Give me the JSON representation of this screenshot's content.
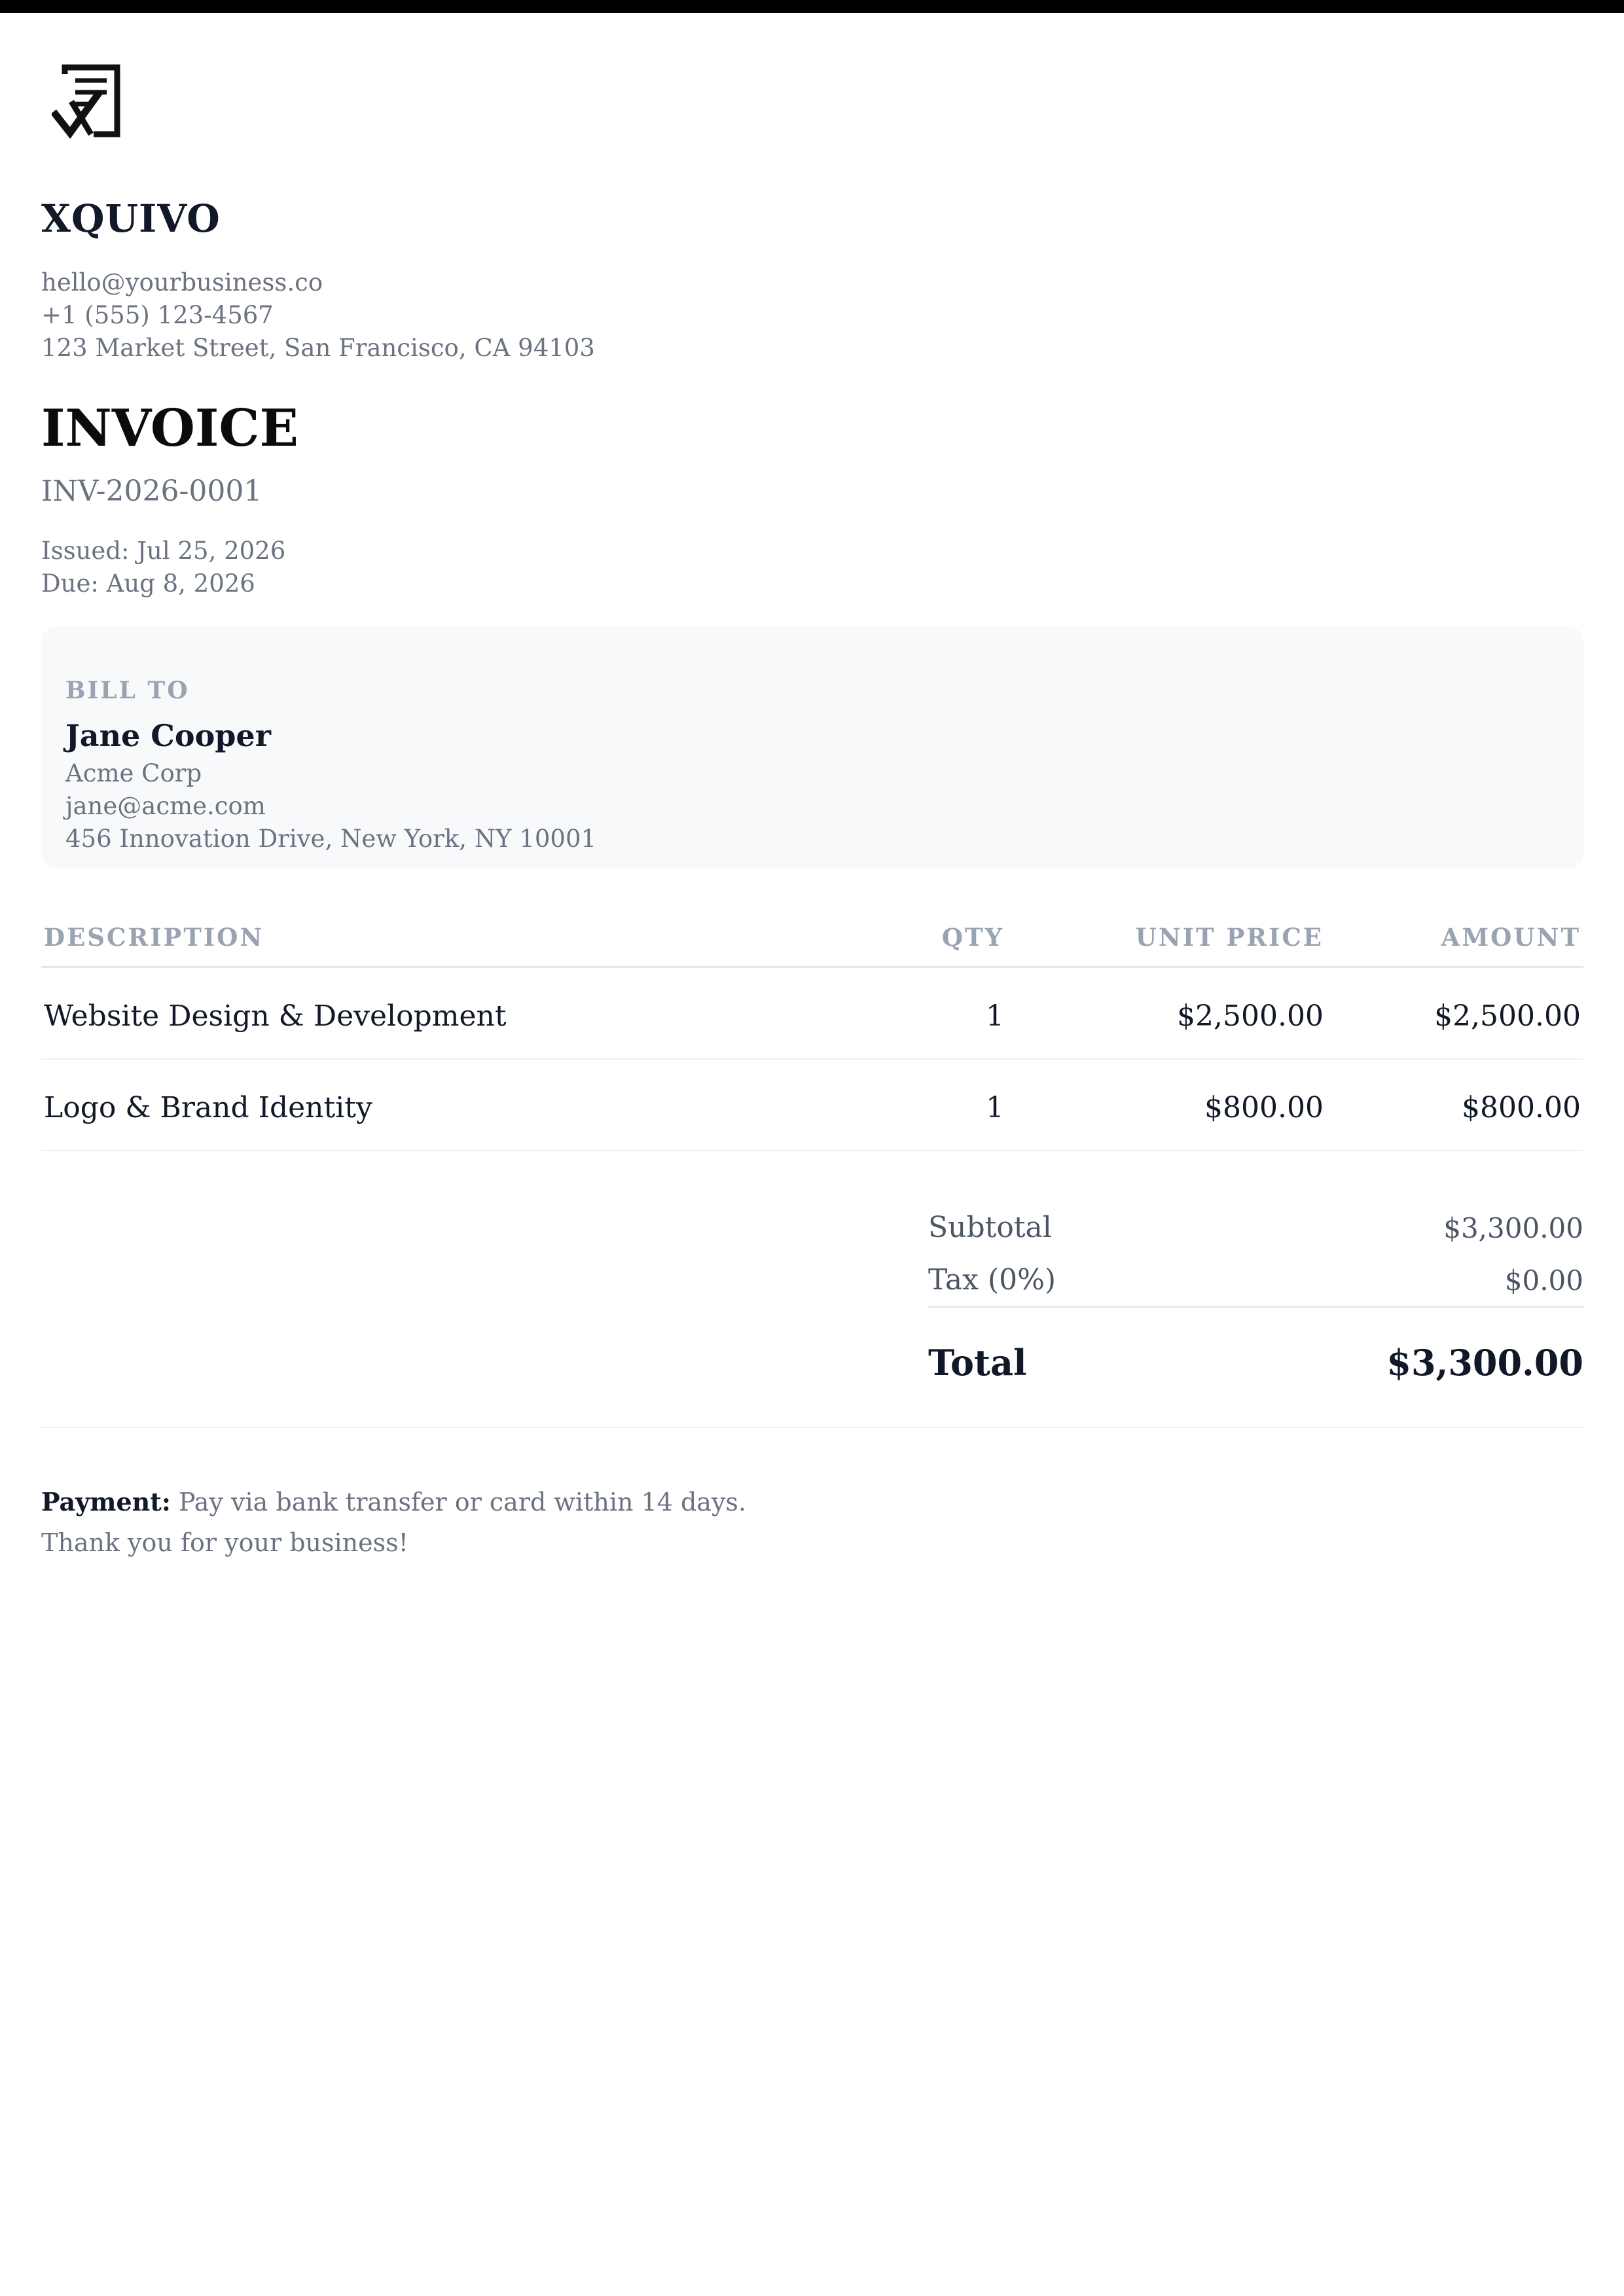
{
  "business": {
    "name": "XQUIVO",
    "email": "hello@yourbusiness.co",
    "phone": "+1 (555) 123-4567",
    "address": "123 Market Street, San Francisco, CA 94103",
    "logo_icon": "receipt-check-icon"
  },
  "invoice": {
    "title": "INVOICE",
    "number": "INV-2026-0001",
    "issued": "Issued: Jul 25, 2026",
    "due": "Due: Aug 8, 2026"
  },
  "bill_to": {
    "label": "BILL TO",
    "name": "Jane Cooper",
    "company": "Acme Corp",
    "email": "jane@acme.com",
    "address": "456 Innovation Drive, New York, NY 10001"
  },
  "table": {
    "headers": {
      "description": "DESCRIPTION",
      "qty": "QTY",
      "unit_price": "UNIT PRICE",
      "amount": "AMOUNT"
    },
    "rows": [
      {
        "description": "Website Design & Development",
        "qty": "1",
        "unit_price": "$2,500.00",
        "amount": "$2,500.00"
      },
      {
        "description": "Logo & Brand Identity",
        "qty": "1",
        "unit_price": "$800.00",
        "amount": "$800.00"
      }
    ]
  },
  "totals": {
    "subtotal_label": "Subtotal",
    "subtotal_value": "$3,300.00",
    "tax_label": "Tax (0%)",
    "tax_value": "$0.00",
    "total_label": "Total",
    "total_value": "$3,300.00"
  },
  "footer": {
    "payment_label": "Payment:",
    "payment_text": " Pay via bank transfer or card within 14 days.",
    "thanks": "Thank you for your business!"
  },
  "colors": {
    "text": "#111827",
    "muted": "#6b7280",
    "header_muted": "#9aa3b1",
    "bill_bg": "#f8f9fb"
  }
}
